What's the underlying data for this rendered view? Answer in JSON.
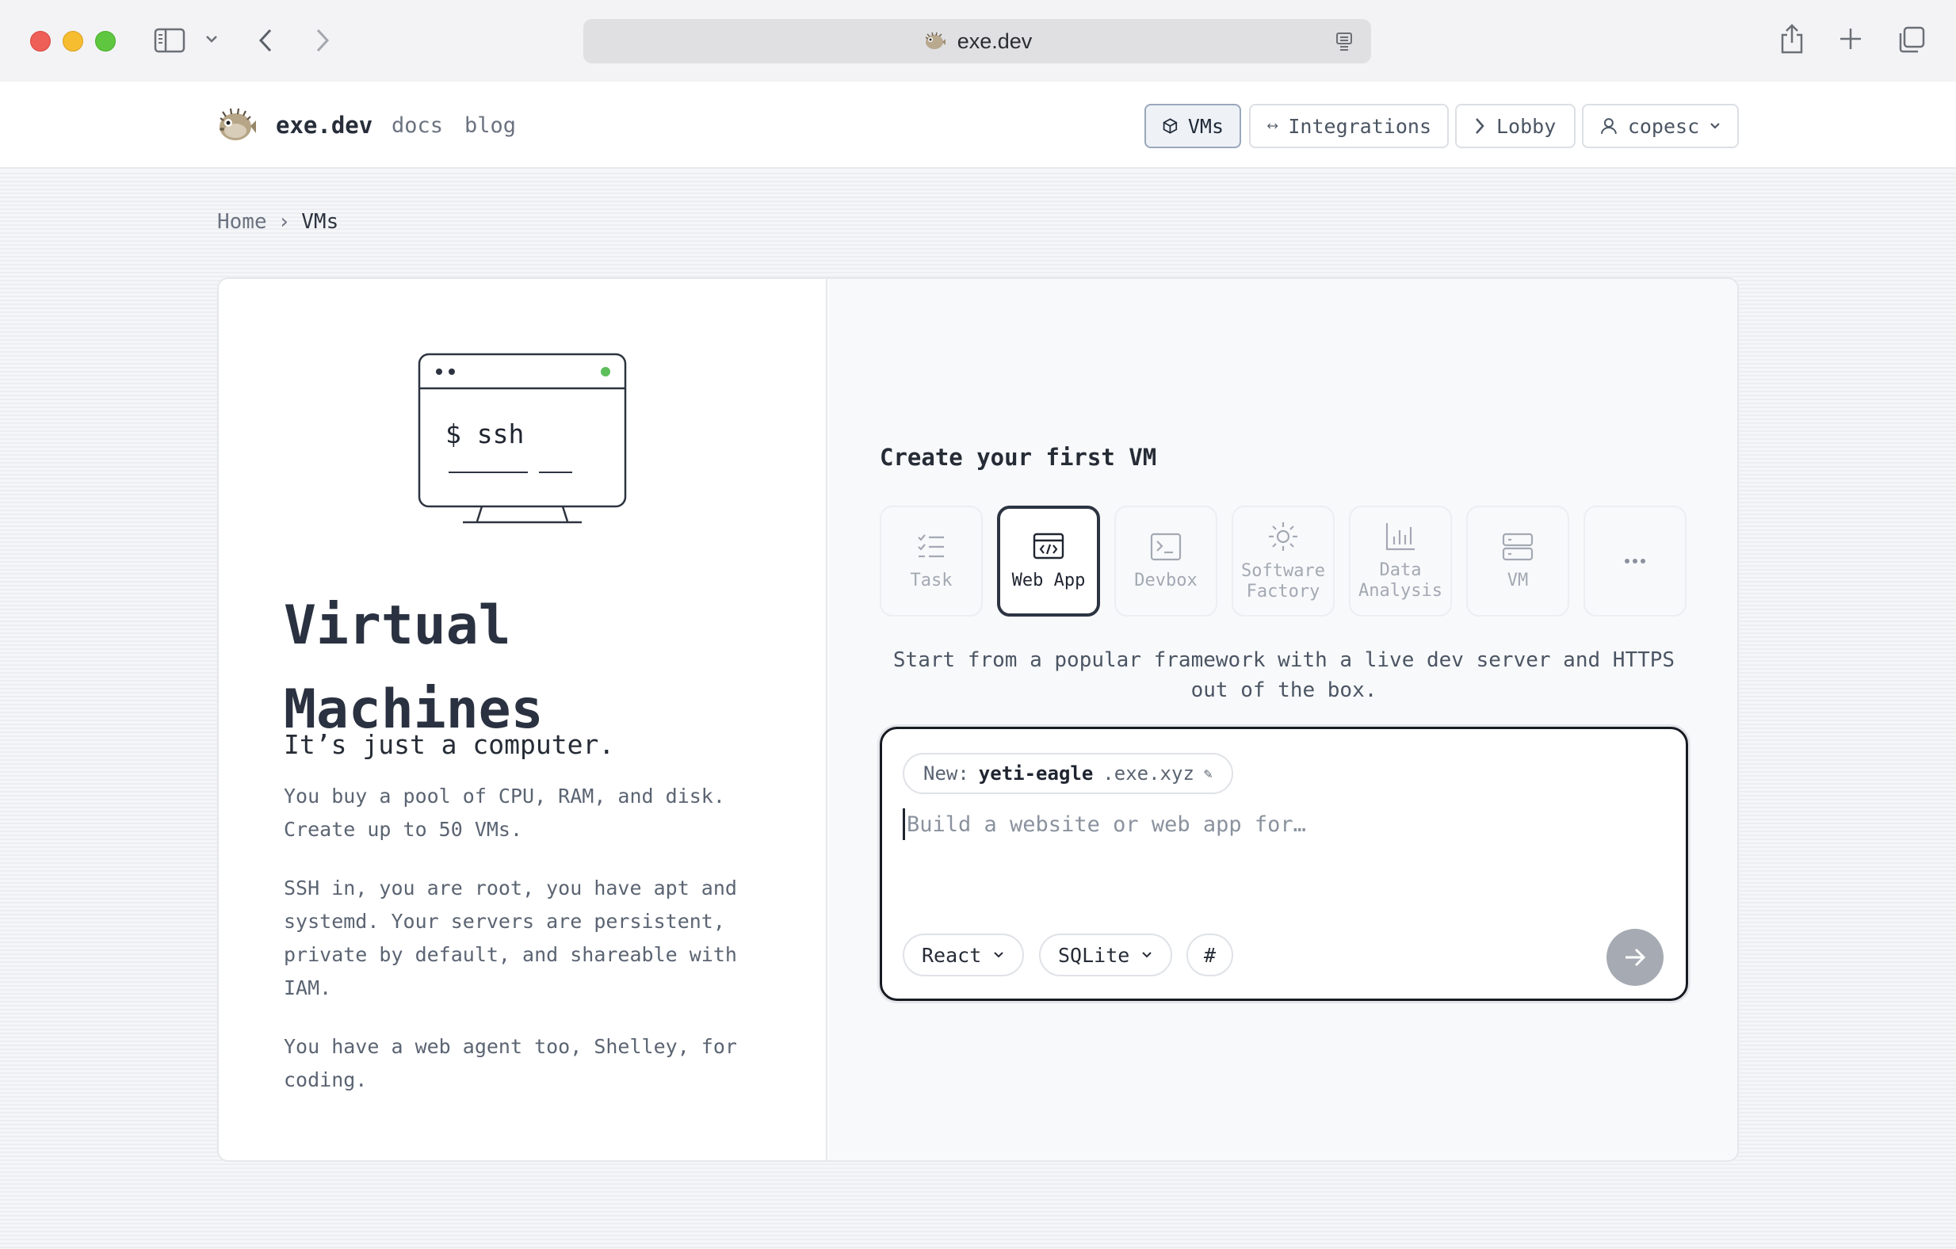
{
  "browser": {
    "url": "exe.dev"
  },
  "header": {
    "brand": "exe.dev",
    "nav": [
      "docs",
      "blog"
    ],
    "buttons": {
      "vms": "VMs",
      "integrations": "Integrations",
      "lobby": "Lobby",
      "user": "copesc"
    }
  },
  "breadcrumb": {
    "home": "Home",
    "separator": "›",
    "current": "VMs"
  },
  "left": {
    "terminal_text": "$ ssh",
    "title_line1": "Virtual",
    "title_line2": "Machines",
    "subtitle": "It’s just a computer.",
    "paragraphs": [
      "You buy a pool of CPU, RAM, and disk. Create up to 50 VMs.",
      "SSH in, you are root, you have apt and systemd. Your servers are persistent, private by default, and shareable with IAM.",
      "You have a web agent too, Shelley, for coding."
    ]
  },
  "create": {
    "title": "Create your first VM",
    "tiles": [
      {
        "label": "Task",
        "icon": "task-list-icon"
      },
      {
        "label": "Web App",
        "icon": "web-app-icon",
        "selected": true
      },
      {
        "label": "Devbox",
        "icon": "terminal-icon"
      },
      {
        "label": "Software Factory",
        "icon": "sun-gear-icon"
      },
      {
        "label": "Data Analysis",
        "icon": "bar-chart-icon"
      },
      {
        "label": "VM",
        "icon": "server-icon"
      },
      {
        "label": "",
        "icon": "more-icon"
      }
    ],
    "description": "Start from a popular framework with a live dev server and HTTPS out of the box.",
    "name_prefix": "New:",
    "vm_name": "yeti-eagle",
    "domain_suffix": ".exe.xyz",
    "edit_glyph": "✎",
    "placeholder": "Build a website or web app for…",
    "framework": "React",
    "database": "SQLite",
    "hash_label": "#"
  },
  "colors": {
    "accent_dark": "#2c3442",
    "status_green": "#5cbf5a",
    "send_button": "#a6abb3"
  }
}
